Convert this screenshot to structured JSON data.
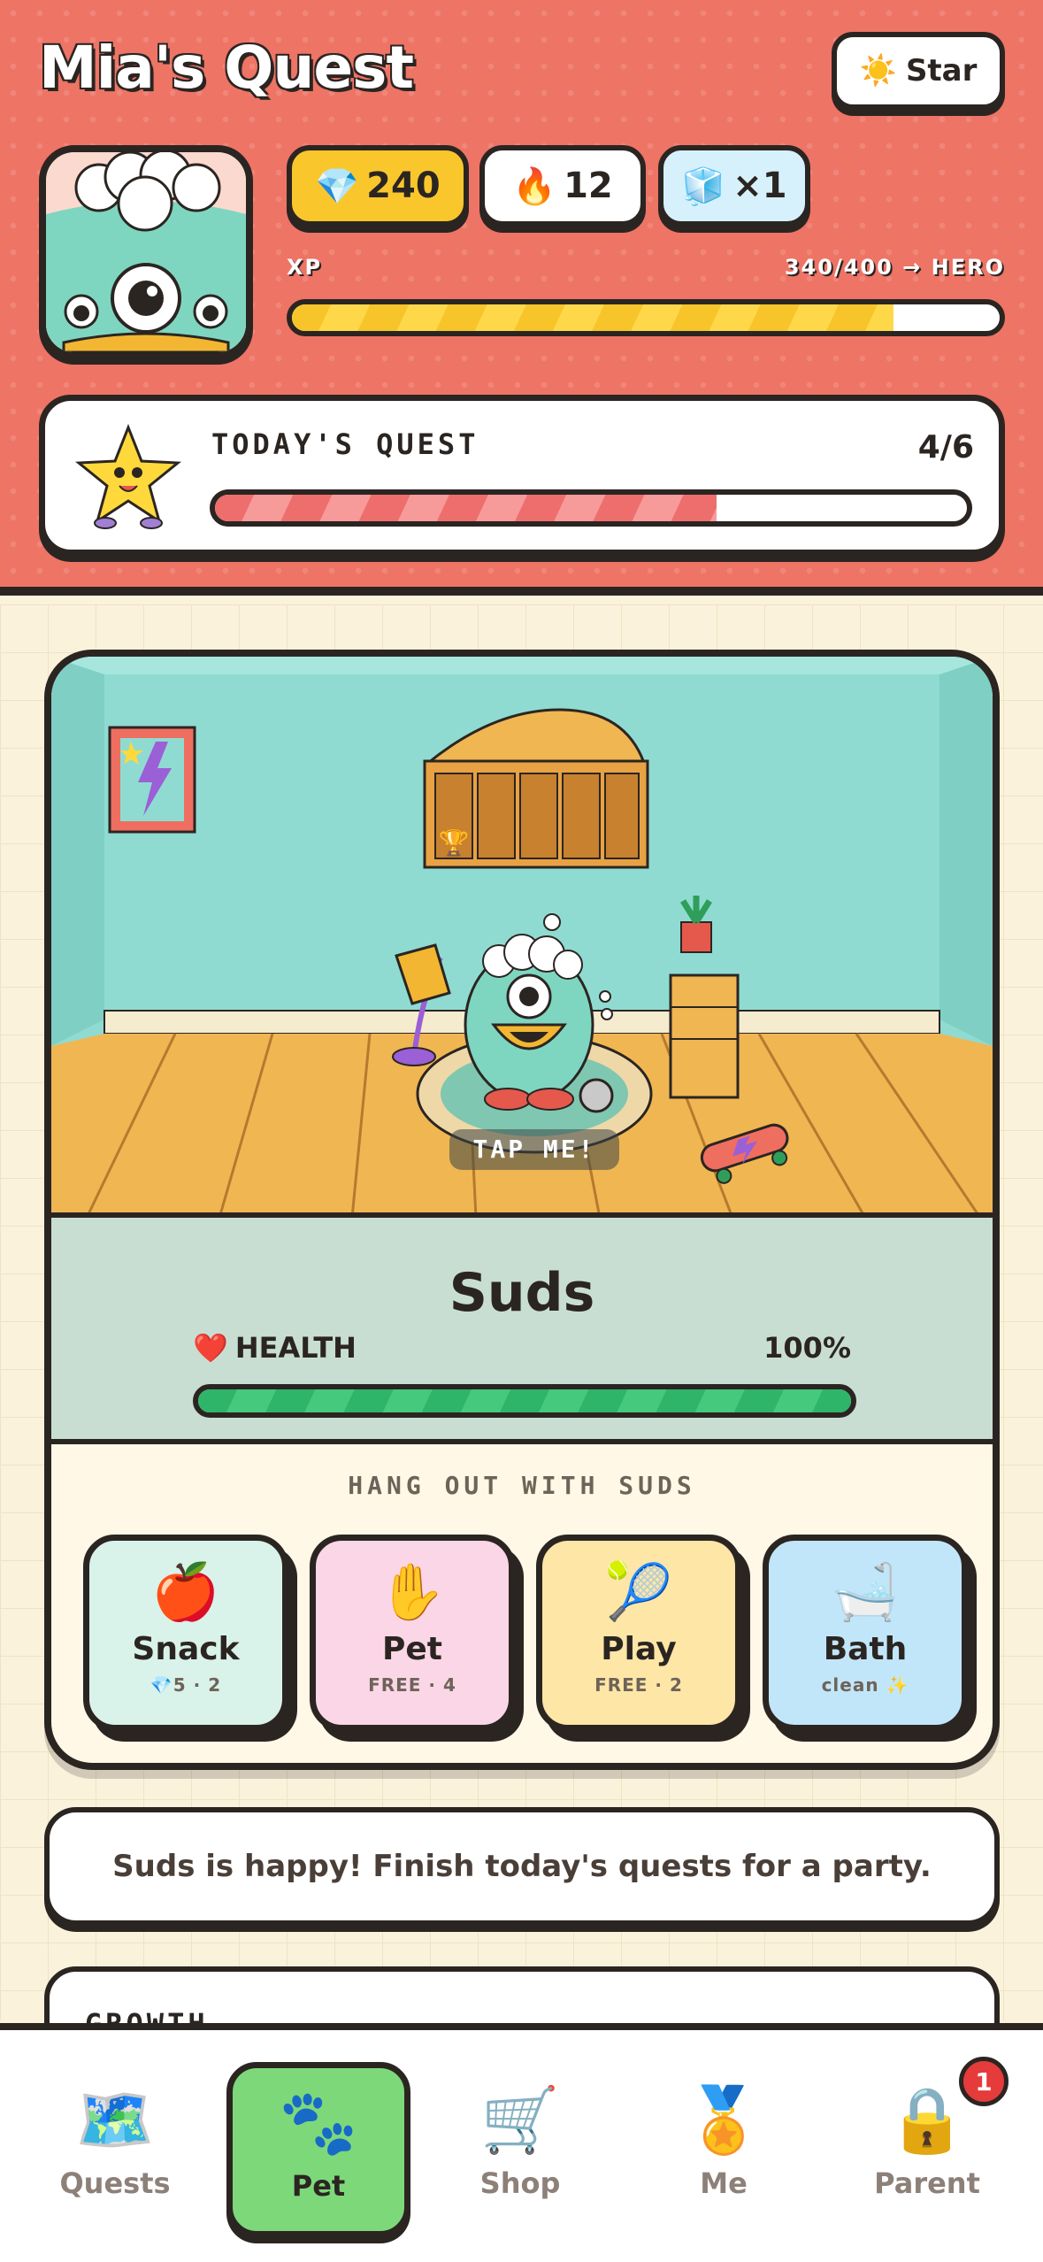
{
  "header": {
    "title": "Mia's Quest",
    "star_label": "Star",
    "star_icon": "☀️"
  },
  "stats": {
    "gems": "240",
    "streak": "12",
    "freeze": "×1"
  },
  "xp": {
    "label": "XP",
    "progress_text": "340/400 → HERO",
    "fraction": 0.85
  },
  "quest": {
    "title": "TODAY'S QUEST",
    "count": "4/6",
    "fraction": 0.667
  },
  "pet": {
    "tap_label": "TAP ME!",
    "name": "Suds",
    "health_label": "HEALTH",
    "health_value": "100%",
    "health_fraction": 1.0
  },
  "hangout": {
    "title": "HANG OUT WITH SUDS",
    "actions": [
      {
        "label": "Snack",
        "sub": "💎5 · 2",
        "icon": "🍎",
        "color": "#d9f2ea"
      },
      {
        "label": "Pet",
        "sub": "FREE · 4",
        "icon": "✋",
        "color": "#fbd6e6"
      },
      {
        "label": "Play",
        "sub": "FREE · 2",
        "icon": "🎾",
        "color": "#fde6a6"
      },
      {
        "label": "Bath",
        "sub": "clean ✨",
        "icon": "🛁",
        "color": "#c2e6f9"
      }
    ]
  },
  "message": "Suds is happy! Finish today's quests for a party.",
  "growth": {
    "title": "GROWTH"
  },
  "nav": {
    "items": [
      {
        "label": "Quests",
        "icon": "🗺️"
      },
      {
        "label": "Pet",
        "icon": "🐾"
      },
      {
        "label": "Shop",
        "icon": "🛒"
      },
      {
        "label": "Me",
        "icon": "🏅"
      },
      {
        "label": "Parent",
        "icon": "🔒"
      }
    ],
    "parent_badge": "1",
    "active": "Pet"
  },
  "colors": {
    "accent": "#ee7466",
    "outline": "#2b2522",
    "xp": "#f7c52a",
    "quest": "#ee6e6e",
    "health": "#2fb56a",
    "active_tab": "#7dd87a"
  }
}
